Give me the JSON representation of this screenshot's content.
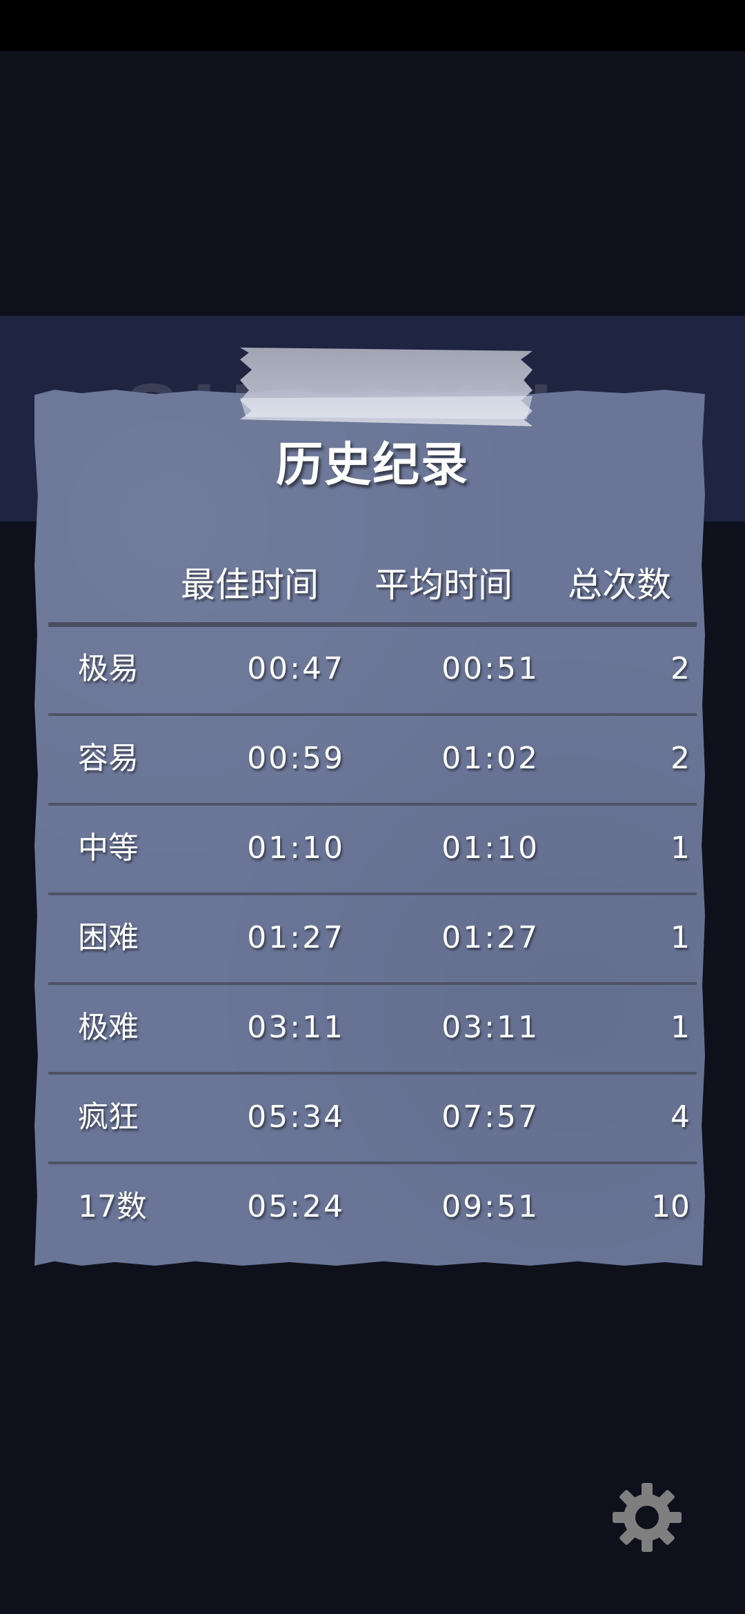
{
  "background_title": "SUDOKU",
  "dialog": {
    "title": "历史纪录",
    "columns": {
      "best_time": "最佳时间",
      "average_time": "平均时间",
      "total_count": "总次数"
    },
    "rows": [
      {
        "level": "极易",
        "best": "00:47",
        "average": "00:51",
        "count": "2"
      },
      {
        "level": "容易",
        "best": "00:59",
        "average": "01:02",
        "count": "2"
      },
      {
        "level": "中等",
        "best": "01:10",
        "average": "01:10",
        "count": "1"
      },
      {
        "level": "困难",
        "best": "01:27",
        "average": "01:27",
        "count": "1"
      },
      {
        "level": "极难",
        "best": "03:11",
        "average": "03:11",
        "count": "1"
      },
      {
        "level": "疯狂",
        "best": "05:34",
        "average": "07:57",
        "count": "4"
      },
      {
        "level": "17数",
        "best": "05:24",
        "average": "09:51",
        "count": "10"
      }
    ]
  },
  "icons": {
    "settings": "gear-icon"
  },
  "colors": {
    "background": "#0e111c",
    "header_band": "#1f2440",
    "paper": "#6a7597",
    "rule": "#4d5366",
    "text": "#ffffff"
  }
}
